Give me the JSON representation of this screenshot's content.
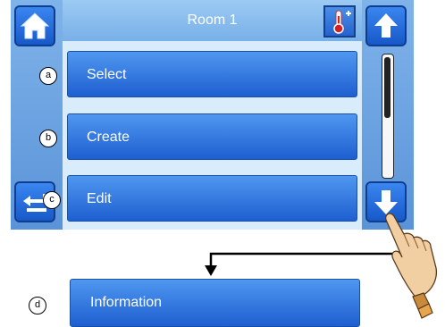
{
  "header": {
    "title": "Room 1"
  },
  "menu": {
    "items": [
      {
        "label": "Select",
        "marker": "a"
      },
      {
        "label": "Create",
        "marker": "b"
      },
      {
        "label": "Edit",
        "marker": "c"
      }
    ]
  },
  "callout": {
    "label": "Information",
    "marker": "d"
  },
  "icons": {
    "home": "home-icon",
    "back": "back-arrow-icon",
    "up": "up-arrow-icon",
    "down": "down-arrow-icon",
    "thermometer": "thermometer-plus-icon",
    "pointer": "pointing-hand-icon"
  },
  "colors": {
    "button_blue": "#2a6ee0",
    "panel_light": "#d8ecfb",
    "frame_blue": "#5b8fd0"
  }
}
